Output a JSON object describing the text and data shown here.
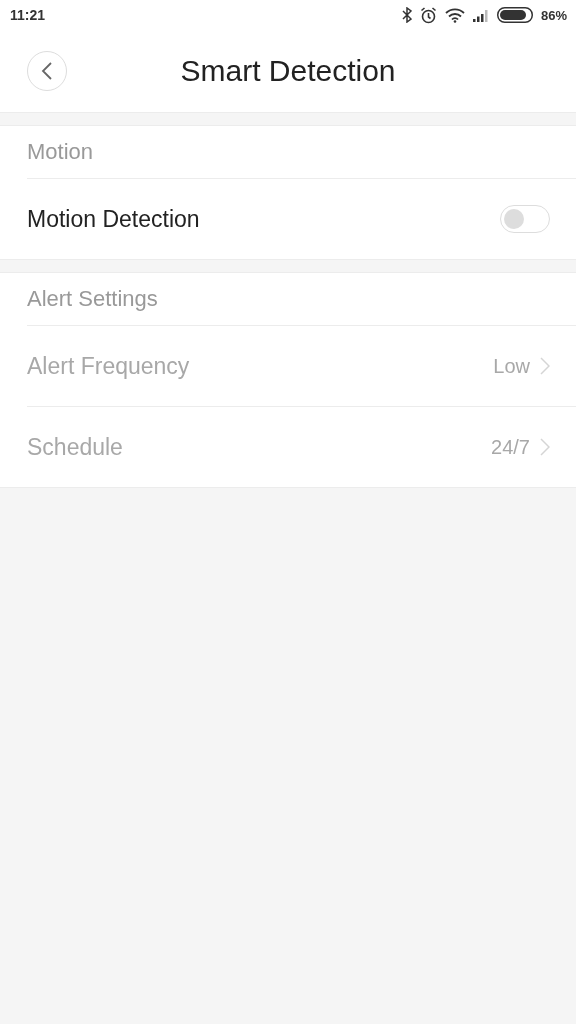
{
  "status_bar": {
    "time": "11:21",
    "battery": "86%"
  },
  "header": {
    "title": "Smart Detection"
  },
  "sections": [
    {
      "title": "Motion",
      "items": [
        {
          "kind": "toggle",
          "label": "Motion Detection",
          "on": false,
          "disabled": false
        }
      ]
    },
    {
      "title": "Alert Settings",
      "items": [
        {
          "kind": "link",
          "label": "Alert Frequency",
          "value": "Low",
          "disabled": true
        },
        {
          "kind": "link",
          "label": "Schedule",
          "value": "24/7",
          "disabled": true
        }
      ]
    }
  ]
}
